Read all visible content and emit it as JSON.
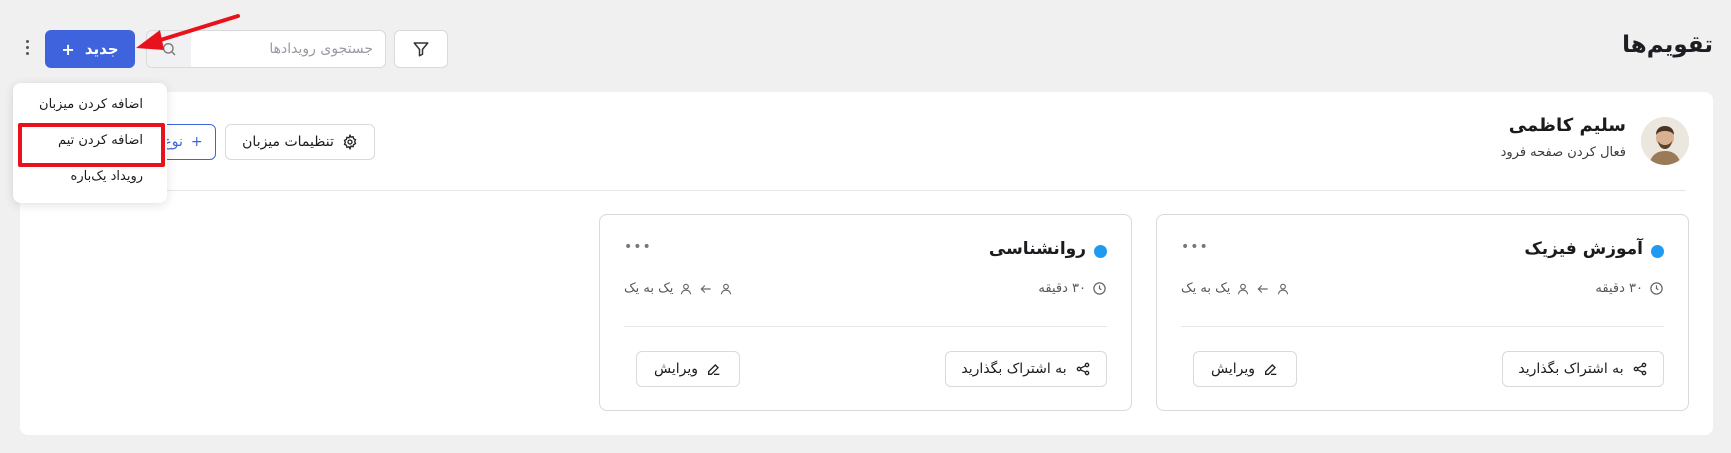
{
  "header": {
    "title": "تقویم‌ها",
    "search_placeholder": "جستجوی رویدادها",
    "new_label": "جدید"
  },
  "host": {
    "name": "سلیم کاظمی",
    "subtitle": "فعال کردن صفحه فرود",
    "settings_label": "تنظیمات میزبان",
    "event_type_label": "نوع"
  },
  "cards": [
    {
      "title": "آموزش فیزیک",
      "dot_color": "#1e9bf0",
      "duration": "۳۰ دقیقه",
      "mode": "یک به یک",
      "share_label": "به اشتراک بگذارید",
      "edit_label": "ویرایش",
      "more": "•••"
    },
    {
      "title": "روانشناسی",
      "dot_color": "#1e9bf0",
      "duration": "۳۰ دقیقه",
      "mode": "یک به یک",
      "share_label": "به اشتراک بگذارید",
      "edit_label": "ویرایش",
      "more": "•••"
    }
  ],
  "menu": {
    "items": [
      {
        "label": "اضافه کردن میزبان"
      },
      {
        "label": "اضافه کردن تیم"
      },
      {
        "label": "رویداد یک‌باره"
      }
    ]
  },
  "colors": {
    "accent": "#3e63dd",
    "highlight": "#e8121c"
  }
}
